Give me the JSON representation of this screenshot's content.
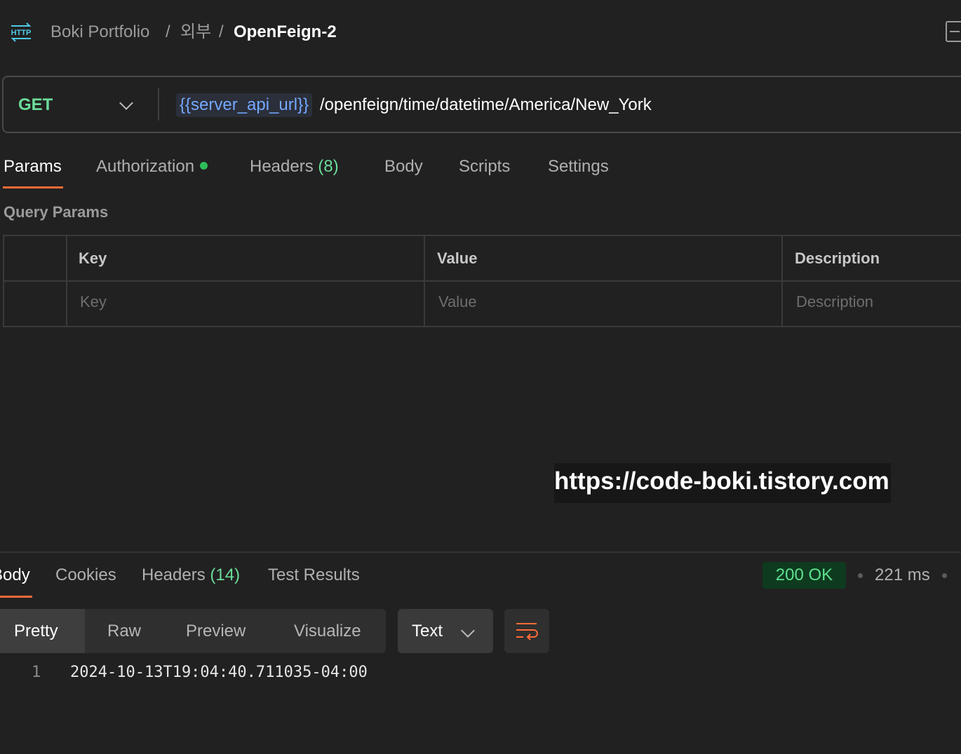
{
  "header": {
    "breadcrumb": [
      "Boki Portfolio",
      "/",
      "외부",
      "/",
      "OpenFeign-2"
    ],
    "icon": "http-icon"
  },
  "request": {
    "method": "GET",
    "url_variable": "{{server_api_url}}",
    "url_path": "/openfeign/time/datetime/America/New_York"
  },
  "request_tabs": {
    "params": "Params",
    "authorization": "Authorization",
    "headers": "Headers",
    "headers_count": "(8)",
    "body": "Body",
    "scripts": "Scripts",
    "settings": "Settings"
  },
  "query_params": {
    "title": "Query Params",
    "columns": [
      "Key",
      "Value",
      "Description"
    ],
    "placeholders": [
      "Key",
      "Value",
      "Description"
    ]
  },
  "watermark": "https://code-boki.tistory.com",
  "response": {
    "tabs": {
      "body": "Body",
      "cookies": "Cookies",
      "headers": "Headers",
      "headers_count": "(14)",
      "tests": "Test Results"
    },
    "status": "200 OK",
    "time": "221 ms",
    "view_modes": [
      "Pretty",
      "Raw",
      "Preview",
      "Visualize"
    ],
    "format": "Text",
    "lines": [
      {
        "no": "1",
        "text": "2024-10-13T19:04:40.711035-04:00"
      }
    ]
  },
  "colors": {
    "accent": "#ff6c37",
    "method_get": "#6bdd9a",
    "status_ok": "#5ee08f",
    "variable": "#74a8ff"
  }
}
